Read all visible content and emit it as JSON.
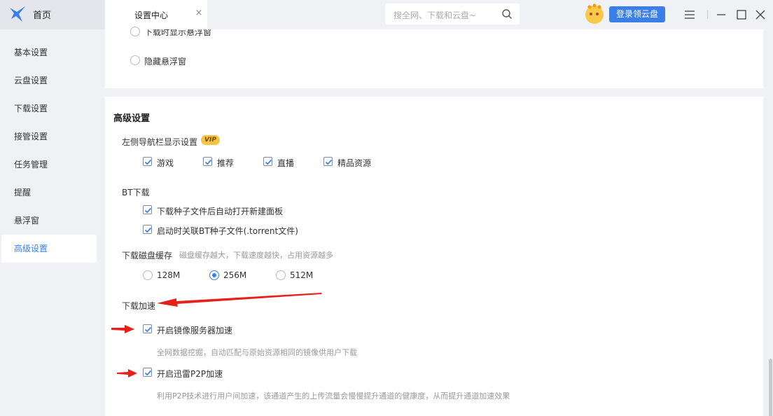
{
  "titlebar": {
    "home_label": "首页",
    "settings_tab_label": "设置中心",
    "close_glyph": "×",
    "search_placeholder": "搜全网、下载和云盘~",
    "login_label": "登录领云盘",
    "icons": [
      "logo-icon",
      "close-icon",
      "search-icon",
      "avatar-icon",
      "menu-icon",
      "minimize-icon",
      "maximize-icon",
      "close-window-icon"
    ]
  },
  "sidebar": {
    "items": [
      {
        "label": "基本设置",
        "active": false
      },
      {
        "label": "云盘设置",
        "active": false
      },
      {
        "label": "下载设置",
        "active": false
      },
      {
        "label": "接管设置",
        "active": false
      },
      {
        "label": "任务管理",
        "active": false
      },
      {
        "label": "提醒",
        "active": false
      },
      {
        "label": "悬浮窗",
        "active": false
      },
      {
        "label": "高级设置",
        "active": true
      }
    ]
  },
  "floating_window": {
    "option_show_during_download": "下载时显示悬浮窗",
    "option_hide": "隐藏悬浮窗"
  },
  "advanced": {
    "title": "高级设置",
    "nav_display": {
      "label": "左侧导航栏显示设置",
      "badge": "VIP",
      "options": [
        {
          "label": "游戏",
          "checked": true
        },
        {
          "label": "推荐",
          "checked": true
        },
        {
          "label": "直播",
          "checked": true
        },
        {
          "label": "精品资源",
          "checked": true
        }
      ]
    },
    "bt": {
      "label": "BT下载",
      "options": [
        {
          "label": "下载种子文件后自动打开新建面板",
          "checked": true
        },
        {
          "label": "启动时关联BT种子文件(.torrent文件)",
          "checked": true
        }
      ]
    },
    "disk_cache": {
      "label": "下载磁盘缓存",
      "hint": "磁盘缓存越大，下载速度越快，占用资源越多",
      "options": [
        "128M",
        "256M",
        "512M"
      ],
      "selected": "256M"
    },
    "acceleration": {
      "label": "下载加速",
      "mirror": {
        "label": "开启镜像服务器加速",
        "checked": true,
        "desc": "全网数据挖掘，自动匹配与原始资源相同的镜像供用户下载"
      },
      "p2p": {
        "label": "开启迅雷P2P加速",
        "checked": true,
        "desc": "利用P2P技术进行用户间加速，该通道产生的上传流量会慢慢提升通道的健康度，从而提升通道加速效果"
      }
    }
  },
  "colors": {
    "accent": "#3a7fe8",
    "arrow": "#e8201a",
    "vip": "#f7c342"
  }
}
